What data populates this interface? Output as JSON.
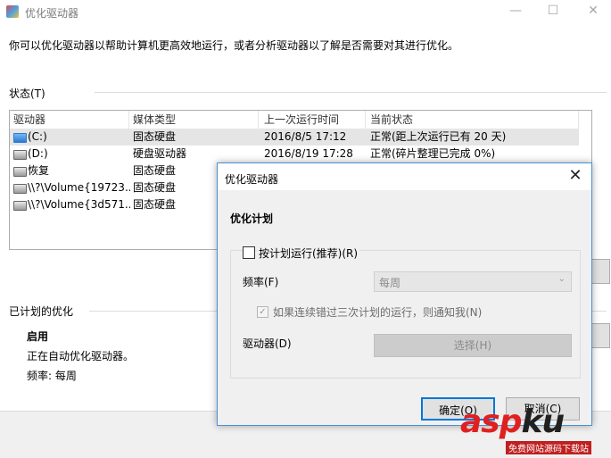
{
  "window": {
    "title": "优化驱动器",
    "description": "你可以优化驱动器以帮助计算机更高效地运行，或者分析驱动器以了解是否需要对其进行优化。",
    "minimize": "—",
    "maximize": "☐",
    "close": "✕"
  },
  "status": {
    "label": "状态(T)",
    "columns": [
      "驱动器",
      "媒体类型",
      "上一次运行时间",
      "当前状态"
    ],
    "rows": [
      {
        "drive": "(C:)",
        "media": "固态硬盘",
        "last_run": "2016/8/5 17:12",
        "state": "正常(距上次运行已有 20 天)",
        "selected": true
      },
      {
        "drive": "(D:)",
        "media": "硬盘驱动器",
        "last_run": "2016/8/19 17:28",
        "state": "正常(碎片整理已完成 0%)"
      },
      {
        "drive": "恢复",
        "media": "固态硬盘",
        "last_run": "",
        "state": ""
      },
      {
        "drive": "\\\\?\\Volume{19723...",
        "media": "固态硬盘",
        "last_run": "",
        "state": ""
      },
      {
        "drive": "\\\\?\\Volume{3d571...",
        "media": "固态硬盘",
        "last_run": "",
        "state": ""
      }
    ]
  },
  "scheduled": {
    "label": "已计划的优化",
    "enabled": "启用",
    "running": "正在自动优化驱动器。",
    "frequency": "频率: 每周"
  },
  "dialog": {
    "title": "优化驱动器",
    "close": "✕",
    "heading": "优化计划",
    "schedule_checkbox": "按计划运行(推荐)(R)",
    "frequency_label": "频率(F)",
    "frequency_value": "每周",
    "notify_label": "如果连续错过三次计划的运行，则通知我(N)",
    "drives_label": "驱动器(D)",
    "choose_button": "选择(H)",
    "ok_button": "确定(O)",
    "cancel_button": "取消(C)"
  },
  "watermark": {
    "brand_a": "asp",
    "brand_b": "ku",
    "sub": "免费网站源码下载站"
  }
}
